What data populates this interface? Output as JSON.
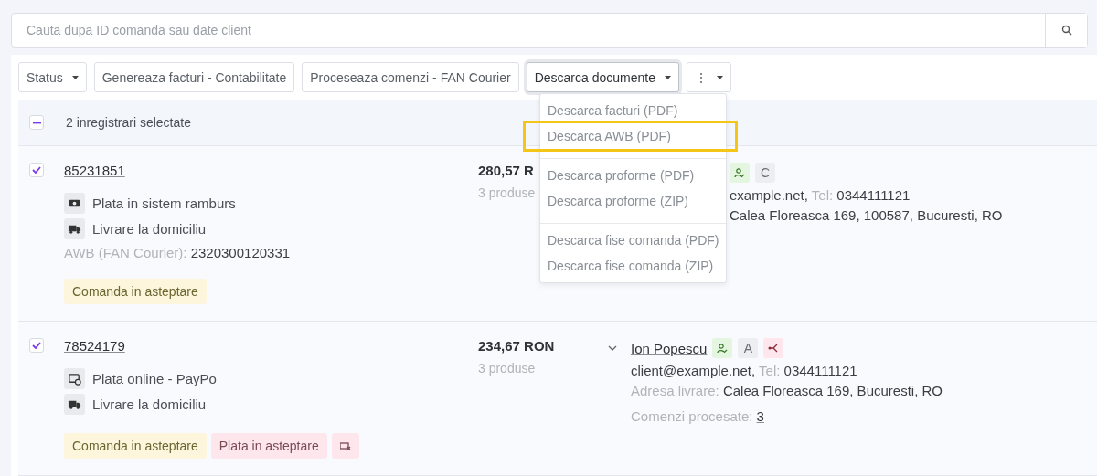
{
  "search": {
    "placeholder": "Cauta dupa ID comanda sau date client"
  },
  "toolbar": [
    {
      "label": "Status",
      "caret": true,
      "open": false
    },
    {
      "label": "Genereaza facturi - Contabilitate",
      "caret": false,
      "open": false
    },
    {
      "label": "Proceseaza comenzi - FAN Courier",
      "caret": false,
      "open": false
    },
    {
      "label": "Descarca documente",
      "caret": true,
      "open": true
    },
    {
      "label": "⋮",
      "caret": true,
      "open": false
    }
  ],
  "menu": [
    {
      "label": "Descarca facturi (PDF)",
      "highlighted": false,
      "divider_before": false
    },
    {
      "label": "Descarca AWB (PDF)",
      "highlighted": true,
      "divider_before": false
    },
    {
      "label": "Descarca proforme (PDF)",
      "highlighted": false,
      "divider_before": true
    },
    {
      "label": "Descarca proforme (ZIP)",
      "highlighted": false,
      "divider_before": false
    },
    {
      "label": "Descarca fise comanda (PDF)",
      "highlighted": false,
      "divider_before": true
    },
    {
      "label": "Descarca fise comanda (ZIP)",
      "highlighted": false,
      "divider_before": false
    }
  ],
  "selection": {
    "checked": true,
    "text": "2 inregistrari selectate"
  },
  "orders": [
    {
      "checked": true,
      "id": "85231851",
      "details": [
        {
          "kind": "cash",
          "text": "Plata in sistem ramburs"
        },
        {
          "kind": "truck",
          "text": "Livrare la domiciliu"
        }
      ],
      "awb_label": "AWB (FAN Courier):",
      "awb": "2320300120331",
      "tags": [
        {
          "kind": "warning",
          "text": "Comanda in asteptare"
        }
      ],
      "total": "280,57 R",
      "products": "3 produse",
      "covered": true,
      "client": {
        "badges": [
          {
            "kind": "verified"
          },
          {
            "kind": "letter",
            "text": "C"
          }
        ],
        "contact": [
          {
            "text": "example.net,"
          },
          {
            "label": "Tel:",
            "text": "0344111121"
          }
        ],
        "address": [
          {
            "text": "Calea Floreasca 169, 100587, Bucuresti, RO"
          }
        ]
      }
    },
    {
      "checked": true,
      "id": "78524179",
      "details": [
        {
          "kind": "card",
          "text": "Plata online - PayPo"
        },
        {
          "kind": "truck",
          "text": "Livrare la domiciliu"
        }
      ],
      "tags": [
        {
          "kind": "warning",
          "text": "Comanda in asteptare"
        },
        {
          "kind": "danger",
          "text": "Plata in asteptare"
        },
        {
          "kind": "danger-icon"
        }
      ],
      "total": "234,67 RON",
      "products": "3 produse",
      "covered": false,
      "client": {
        "name": "Ion Popescu",
        "badges": [
          {
            "kind": "verified"
          },
          {
            "kind": "letter",
            "text": "A"
          },
          {
            "kind": "split"
          }
        ],
        "contact": [
          {
            "text": "client@example.net,"
          },
          {
            "label": "Tel:",
            "text": "0344111121"
          }
        ],
        "address": [
          {
            "label": "Adresa livrare:",
            "text": "Calea Floreasca 169, Bucuresti, RO"
          }
        ],
        "processed_label": "Comenzi procesate:",
        "processed": "3"
      }
    }
  ]
}
